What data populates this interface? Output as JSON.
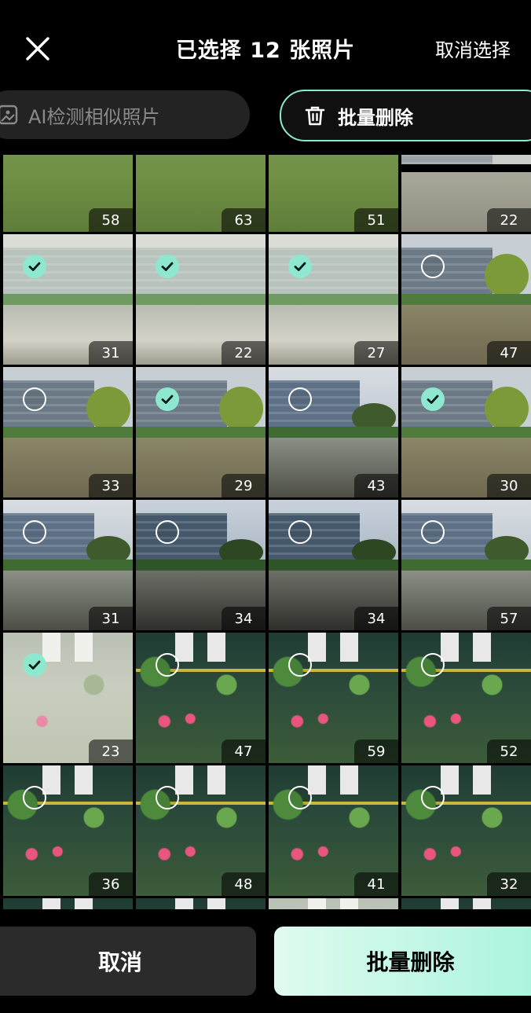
{
  "header": {
    "title": "已选择 12 张照片",
    "deselect_label": "取消选择",
    "close_icon": "close-icon"
  },
  "chips": {
    "ai_detect_label": "AI检测相似照片",
    "ai_detect_icon": "image-icon",
    "batch_delete_label": "批量删除",
    "batch_delete_icon": "trash-icon"
  },
  "colors": {
    "accent": "#8ee8cf",
    "background": "#000000"
  },
  "photos": [
    {
      "count": "58",
      "scene": "lawn"
    },
    {
      "count": "63",
      "scene": "lawn"
    },
    {
      "count": "51",
      "scene": "lawn"
    },
    {
      "count": "22",
      "scene": "pond-mist"
    },
    {
      "count": "31",
      "scene": "pond-train",
      "selected": true
    },
    {
      "count": "22",
      "scene": "pond-train",
      "selected": true
    },
    {
      "count": "27",
      "scene": "pond-train",
      "selected": true
    },
    {
      "count": "47",
      "scene": "building-tree",
      "selected": false
    },
    {
      "count": "33",
      "scene": "building-tree",
      "selected": false
    },
    {
      "count": "29",
      "scene": "building-tree",
      "selected": true
    },
    {
      "count": "43",
      "scene": "pond-clear",
      "selected": false
    },
    {
      "count": "30",
      "scene": "building-tree",
      "selected": true
    },
    {
      "count": "31",
      "scene": "pond-clear",
      "selected": false
    },
    {
      "count": "34",
      "scene": "pond-dark",
      "selected": false
    },
    {
      "count": "34",
      "scene": "pond-dark",
      "selected": false
    },
    {
      "count": "57",
      "scene": "pond-clear",
      "selected": false
    },
    {
      "count": "23",
      "scene": "blossom-faded",
      "selected": true
    },
    {
      "count": "47",
      "scene": "blossom",
      "selected": false
    },
    {
      "count": "59",
      "scene": "blossom",
      "selected": false
    },
    {
      "count": "52",
      "scene": "blossom",
      "selected": false
    },
    {
      "count": "36",
      "scene": "blossom",
      "selected": false
    },
    {
      "count": "48",
      "scene": "blossom",
      "selected": false
    },
    {
      "count": "41",
      "scene": "blossom",
      "selected": false
    },
    {
      "count": "32",
      "scene": "blossom",
      "selected": false
    },
    {
      "count": "",
      "scene": "blossom",
      "selected": false
    },
    {
      "count": "",
      "scene": "blossom",
      "selected": false
    },
    {
      "count": "",
      "scene": "blossom-faded",
      "selected": true
    },
    {
      "count": "",
      "scene": "blossom",
      "selected": false
    }
  ],
  "footer": {
    "cancel_label": "取消",
    "batch_delete_label": "批量删除"
  }
}
